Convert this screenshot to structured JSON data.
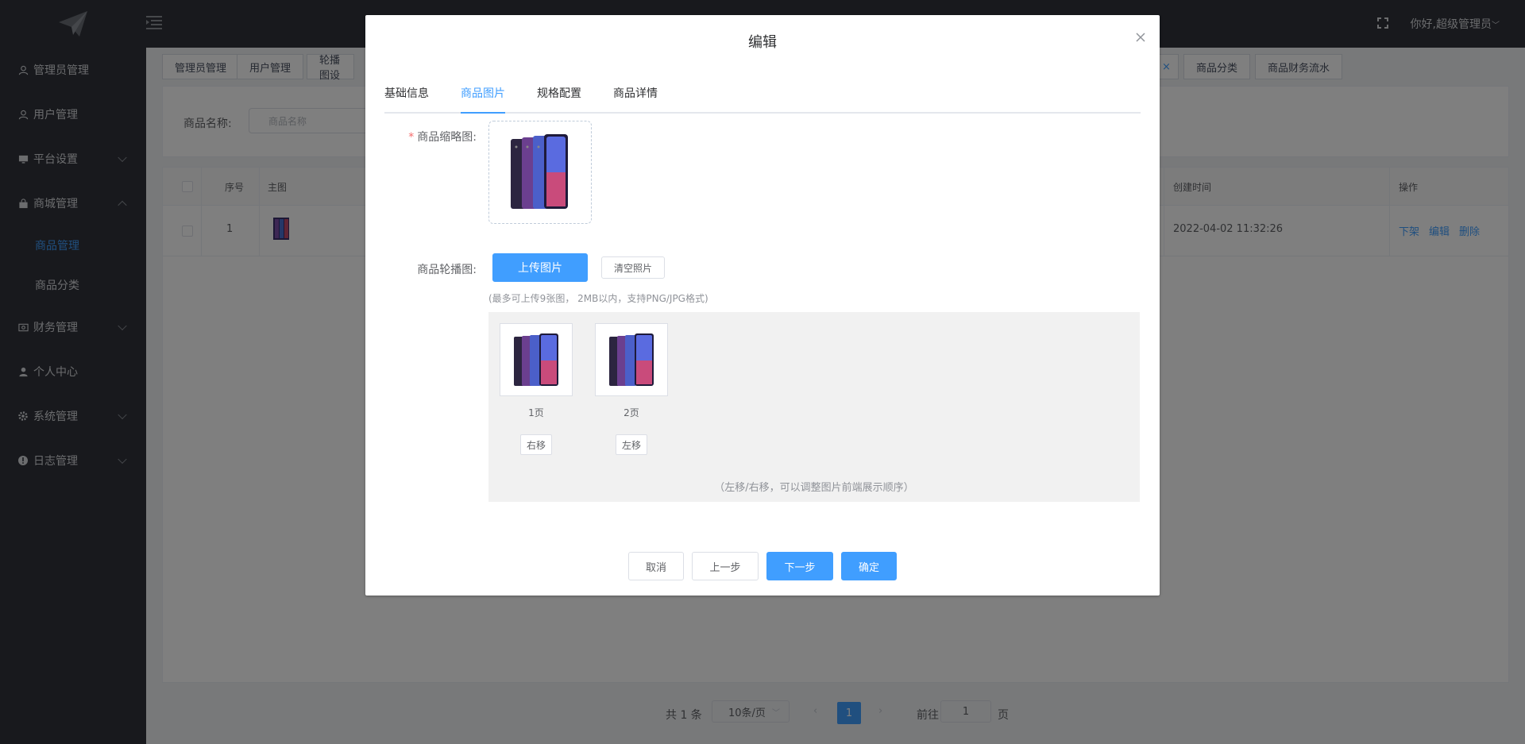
{
  "header": {
    "greeting": "你好,超级管理员"
  },
  "sidebar": {
    "items": [
      {
        "label": "管理员管理",
        "icon": "user-icon"
      },
      {
        "label": "用户管理",
        "icon": "user-icon"
      },
      {
        "label": "平台设置",
        "icon": "monitor-icon"
      },
      {
        "label": "商城管理",
        "icon": "shop-icon"
      },
      {
        "label": "财务管理",
        "icon": "wallet-icon"
      },
      {
        "label": "个人中心",
        "icon": "person-icon"
      },
      {
        "label": "系统管理",
        "icon": "gear-icon"
      },
      {
        "label": "日志管理",
        "icon": "info-icon"
      }
    ],
    "sub_items": [
      {
        "label": "商品管理",
        "active": true
      },
      {
        "label": "商品分类",
        "active": false
      }
    ]
  },
  "tabs": [
    "管理员管理",
    "用户管理",
    "轮播图设",
    "商品分类",
    "商品财务流水"
  ],
  "search": {
    "label": "商品名称:",
    "placeholder": "商品名称"
  },
  "table": {
    "headers": {
      "index": "序号",
      "image": "主图",
      "created": "创建时间",
      "ops": "操作"
    },
    "rows": [
      {
        "index": "1",
        "created": "2022-04-02 11:32:26",
        "ops": [
          "下架",
          "编辑",
          "删除"
        ]
      }
    ]
  },
  "pagination": {
    "total": "共 1 条",
    "page_size": "10条/页",
    "current": "1",
    "goto_label": "前往",
    "goto_value": "1",
    "page_unit": "页"
  },
  "dialog": {
    "title": "编辑",
    "tabs": [
      "基础信息",
      "商品图片",
      "规格配置",
      "商品详情"
    ],
    "active_tab": "商品图片",
    "thumb_label": "商品缩略图:",
    "carousel_label": "商品轮播图:",
    "upload_btn": "上传图片",
    "clear_btn": "清空照片",
    "hint": "(最多可上传9张图， 2MB以内，支持PNG/JPG格式)",
    "gallery": [
      {
        "label": "1页",
        "move": "右移"
      },
      {
        "label": "2页",
        "move": "左移"
      }
    ],
    "gallery_note": "（左移/右移，可以调整图片前端展示顺序）",
    "footer": {
      "cancel": "取消",
      "prev": "上一步",
      "next": "下一步",
      "confirm": "确定"
    }
  },
  "colors": {
    "primary": "#409eff",
    "sidebar_bg": "#30333a",
    "required": "#f56c6c"
  }
}
